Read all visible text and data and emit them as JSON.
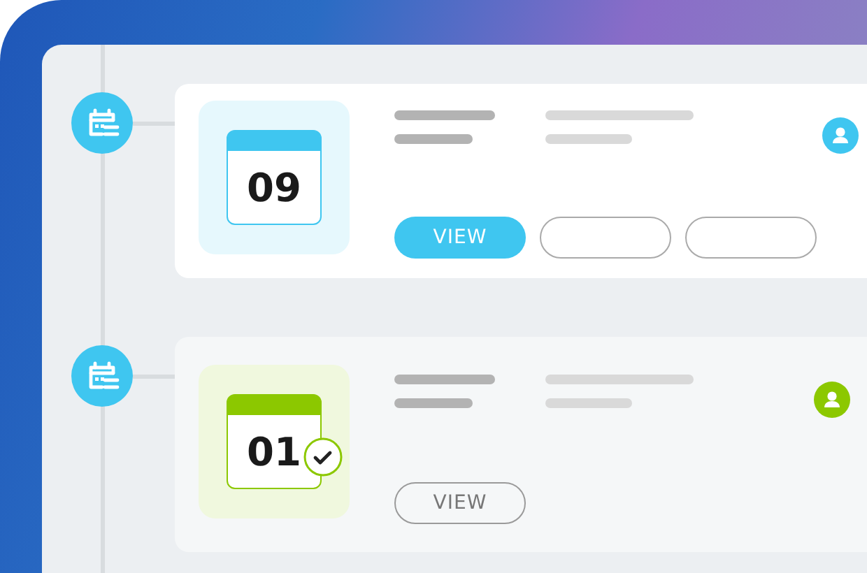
{
  "events": [
    {
      "day": "09",
      "color": "#3fc6f0",
      "checked": false,
      "buttons": [
        {
          "kind": "filled",
          "label": "VIEW"
        },
        {
          "kind": "blank"
        },
        {
          "kind": "blank"
        }
      ]
    },
    {
      "day": "01",
      "color": "#8cc800",
      "checked": true,
      "buttons": [
        {
          "kind": "outline",
          "label": "VIEW"
        }
      ]
    }
  ]
}
